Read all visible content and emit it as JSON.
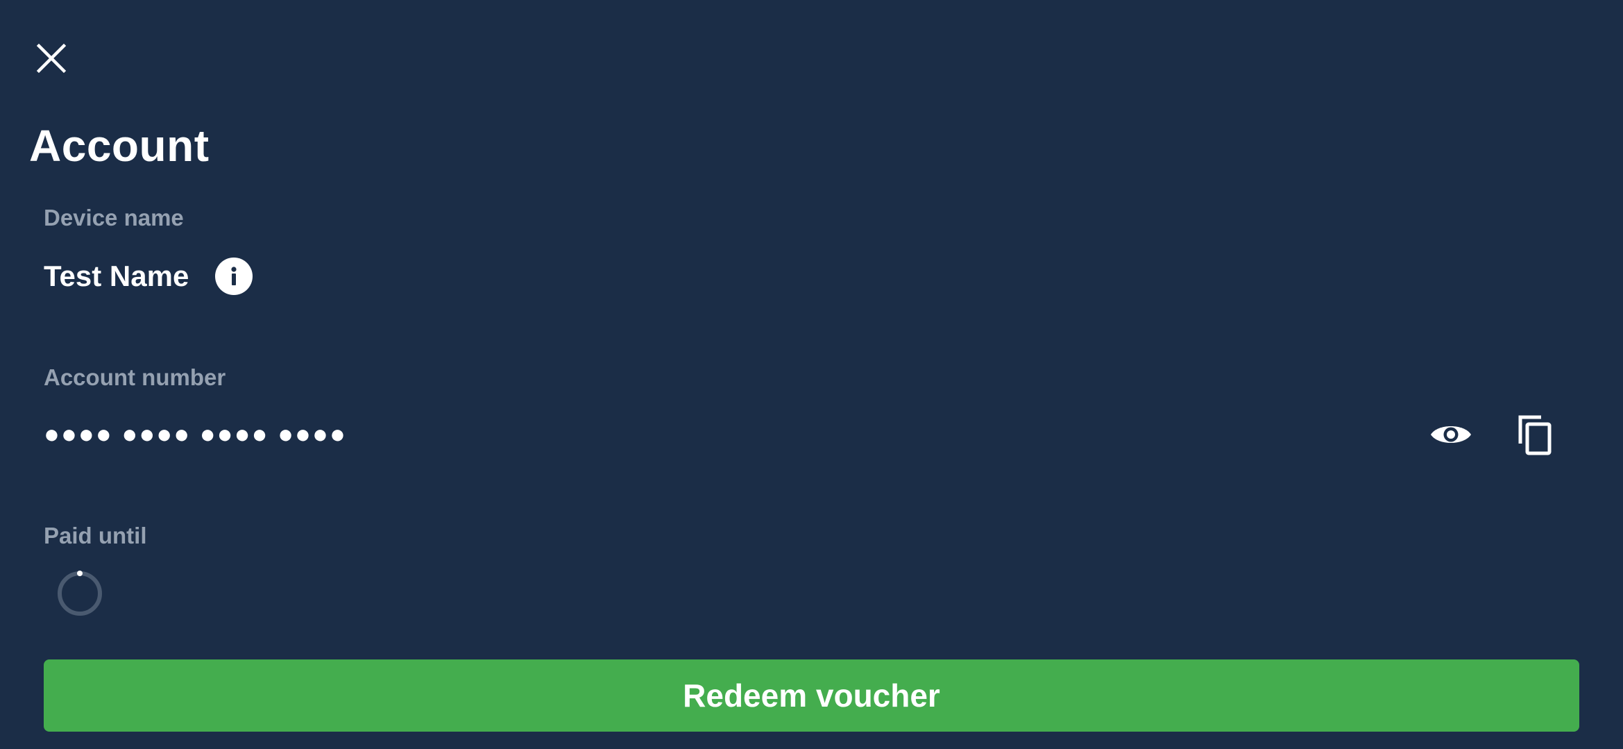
{
  "header": {
    "close_icon": "close-icon",
    "title": "Account"
  },
  "device": {
    "label": "Device name",
    "value": "Test Name",
    "info_icon": "info-icon"
  },
  "account": {
    "label": "Account number",
    "value": "●●●● ●●●● ●●●● ●●●●",
    "show_icon": "eye-icon",
    "copy_icon": "copy-icon"
  },
  "paid_until": {
    "label": "Paid until",
    "status_icon": "loading-spinner-icon"
  },
  "actions": {
    "redeem_label": "Redeem voucher"
  },
  "colors": {
    "background": "#1b2d47",
    "label": "#95a1b1",
    "text": "#ffffff",
    "primary_button": "#44ad4e"
  }
}
